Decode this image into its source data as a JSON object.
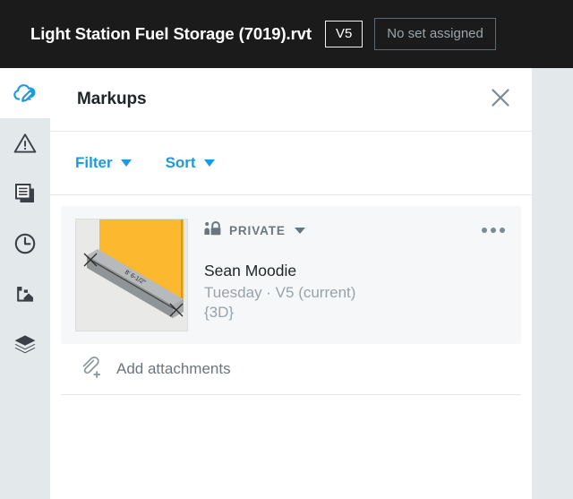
{
  "titlebar": {
    "doc_title": "Light Station Fuel Storage (7019).rvt",
    "version_chip": "V5",
    "set_chip": "No set assigned"
  },
  "rail": {
    "items": [
      {
        "name": "markups",
        "icon": "cloud-pencil-icon",
        "active": true
      },
      {
        "name": "issues",
        "icon": "warning-triangle-icon",
        "active": false
      },
      {
        "name": "documents",
        "icon": "documents-icon",
        "active": false
      },
      {
        "name": "activity",
        "icon": "clock-icon",
        "active": false
      },
      {
        "name": "sheets",
        "icon": "sheets-icon",
        "active": false
      },
      {
        "name": "layers",
        "icon": "layers-icon",
        "active": false
      }
    ]
  },
  "panel": {
    "title": "Markups",
    "close_icon": "close-icon",
    "toolbar": {
      "filter_label": "Filter",
      "sort_label": "Sort"
    },
    "markups": [
      {
        "privacy_label": "PRIVATE",
        "privacy_icon": "person-lock-icon",
        "menu_icon": "kebab-menu-icon",
        "author": "Sean Moodie",
        "meta": "Tuesday · V5 (current)",
        "view": "{3D}",
        "thumbnail": {
          "alt": "3D view markup thumbnail",
          "dimension_label": "8' 6-1/2\"",
          "panel_color": "#fcb82e",
          "beam_color": "#9a9ea0",
          "background_color": "#e9e9e7"
        }
      }
    ],
    "attachments": {
      "label": "Add attachments",
      "icon": "paperclip-plus-icon"
    }
  },
  "colors": {
    "accent": "#1b9ae0",
    "titlebar_bg": "#1b1b1b",
    "rail_bg": "#e3e8ea",
    "panel_bg": "#ffffff",
    "card_bg": "#f6f7f8",
    "muted_text": "#98a3a9"
  }
}
